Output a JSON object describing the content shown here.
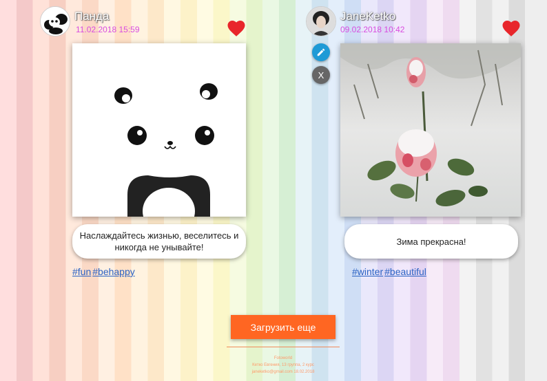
{
  "posts": [
    {
      "username": "Панда",
      "date": "11.02.2018 15:59",
      "caption": "Наслаждайтесь жизнью, веселитесь и никогда не унывайте!",
      "tags": [
        "#fun",
        "#behappy"
      ],
      "liked": true,
      "image_icon": "panda-illustration"
    },
    {
      "username": "JaneKetko",
      "date": "09.02.2018 10:42",
      "caption": "Зима прекрасна!",
      "tags": [
        "#winter",
        "#beautiful"
      ],
      "liked": true,
      "image_icon": "snowy-rose-photo",
      "delete_label": "X"
    }
  ],
  "load_more_label": "Загрузить еще",
  "footer": {
    "line1": "Fotoworld",
    "line2": "Кетко Евгения, 13 группа, 2 курс",
    "line3": "janeketko@gmail.com 18.02.2018"
  },
  "colors": {
    "accent": "#ff6622",
    "heart": "#e8262b",
    "date": "#d94ce0",
    "tag_link": "#2a62c4",
    "edit_button": "#1e9ad6",
    "delete_button": "#666666"
  }
}
